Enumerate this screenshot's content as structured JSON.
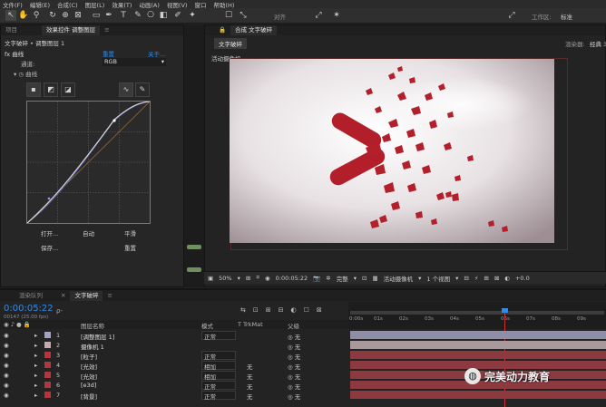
{
  "menubar": {
    "items": [
      "文件(F)",
      "编辑(E)",
      "合成(C)",
      "图层(L)",
      "效果(T)",
      "动画(A)",
      "视图(V)",
      "窗口",
      "帮助(H)"
    ]
  },
  "toolbar": {
    "snap_label": "对齐",
    "workspace_label": "工作区:",
    "workspace_value": "标准"
  },
  "left_panel": {
    "tabs": [
      "项目",
      "效果控件 调整图层",
      "≡"
    ],
    "breadcrumb": "文字破碎 • 调整图层 1",
    "effect_name": "fx 曲线",
    "reset_label": "重置",
    "about_label": "关于...",
    "channel_label": "通道:",
    "channel_value": "RGB",
    "curve_label": "曲线",
    "btn_open": "打开...",
    "btn_auto": "自动",
    "btn_smooth": "平滑",
    "btn_save": "保存...",
    "btn_reset": "重置"
  },
  "comp_panel": {
    "tab": "合成 文字破碎",
    "sub_tab": "文字破碎",
    "renderer_label": "渲染器:",
    "renderer_value": "经典 3D",
    "camera_label": "活动摄像机",
    "footer": {
      "zoom": "50%",
      "timecode": "0:00:05:22",
      "quality": "完整",
      "camera": "活动摄像机",
      "views": "1 个视图",
      "exposure": "+0.0"
    }
  },
  "timeline": {
    "tabs": [
      "渲染队列",
      "文字破碎"
    ],
    "timecode": "0:00:05:22",
    "frame_info": "00147 (25.00 fps)",
    "search_placeholder": "ρ-",
    "col_name": "图层名称",
    "col_mode": "模式",
    "col_trkmat": "T TrkMat",
    "col_parent": "父级",
    "ruler": [
      "0:00s",
      "01s",
      "02s",
      "03s",
      "04s",
      "05s",
      "06s",
      "07s",
      "08s",
      "09s"
    ],
    "layers": [
      {
        "num": "1",
        "name": "[调整图层 1]",
        "mode": "正常",
        "trk": "",
        "parent": "无",
        "color": "#a3a3c8"
      },
      {
        "num": "2",
        "name": "摄像机 1",
        "mode": "",
        "trk": "",
        "parent": "无",
        "color": "#c7a9ad"
      },
      {
        "num": "3",
        "name": "[粒子]",
        "mode": "正常",
        "trk": "",
        "parent": "无",
        "color": "#b6343c"
      },
      {
        "num": "4",
        "name": "[光效]",
        "mode": "相加",
        "trk": "无",
        "parent": "无",
        "color": "#b6343c"
      },
      {
        "num": "5",
        "name": "[光效]",
        "mode": "相加",
        "trk": "无",
        "parent": "无",
        "color": "#b6343c"
      },
      {
        "num": "6",
        "name": "[e3d]",
        "mode": "正常",
        "trk": "无",
        "parent": "无",
        "color": "#b6343c"
      },
      {
        "num": "7",
        "name": "[背景]",
        "mode": "正常",
        "trk": "无",
        "parent": "无",
        "color": "#b6343c"
      }
    ]
  },
  "watermark": {
    "text": "完美动力教育"
  }
}
